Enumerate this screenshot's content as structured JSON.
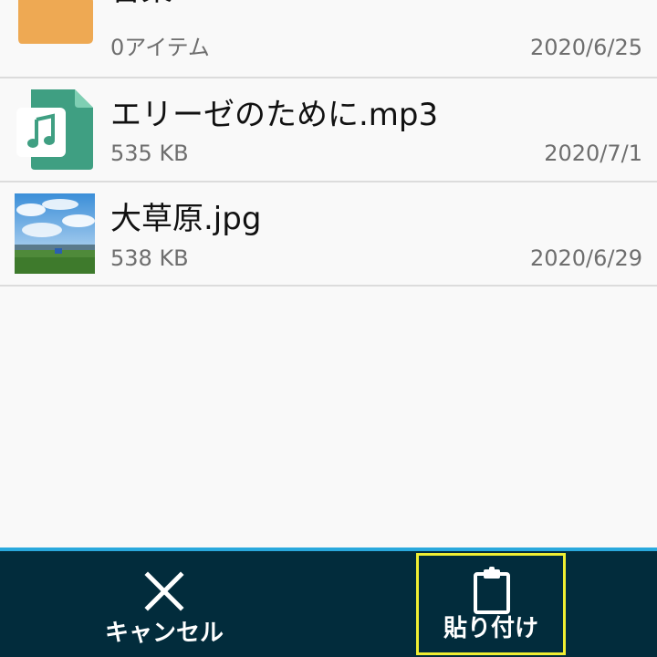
{
  "files": [
    {
      "name": "音楽",
      "meta": "0アイテム",
      "date": "2020/6/25",
      "icon": "folder-icon"
    },
    {
      "name": "エリーゼのために.mp3",
      "meta": "535 KB",
      "date": "2020/7/1",
      "icon": "music-file-icon"
    },
    {
      "name": "大草原.jpg",
      "meta": "538 KB",
      "date": "2020/6/29",
      "icon": "image-thumbnail"
    }
  ],
  "bottom_bar": {
    "cancel_label": "キャンセル",
    "cancel_icon": "close-icon",
    "paste_label": "貼り付け",
    "paste_icon": "clipboard-icon"
  },
  "colors": {
    "background": "#f9f9f9",
    "bar_background": "#022c3c",
    "bar_accent": "#2aa9dd",
    "highlight": "#f0ee32",
    "folder": "#e8a34c",
    "music_file": "#3f9f82"
  }
}
